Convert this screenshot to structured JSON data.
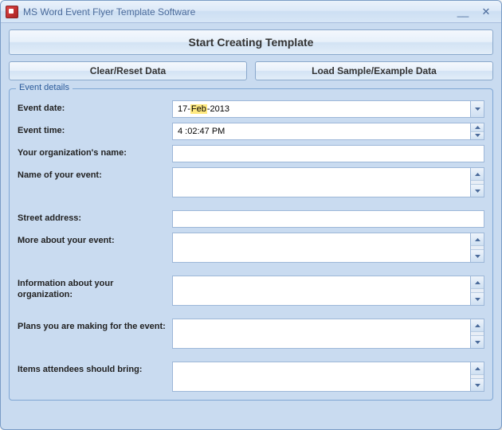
{
  "window": {
    "title": "MS Word Event Flyer Template Software"
  },
  "buttons": {
    "start": "Start Creating Template",
    "clear": "Clear/Reset Data",
    "load": "Load Sample/Example Data"
  },
  "group": {
    "legend": "Event details"
  },
  "form": {
    "event_date": {
      "label": "Event date:",
      "day": "17-",
      "month": "Feb",
      "year": "-2013"
    },
    "event_time": {
      "label": "Event time:",
      "value": " 4 :02:47 PM"
    },
    "org_name": {
      "label": "Your organization's name:",
      "value": ""
    },
    "event_name": {
      "label": "Name of your event:",
      "value": ""
    },
    "street": {
      "label": "Street address:",
      "value": ""
    },
    "more": {
      "label": "More about your event:",
      "value": ""
    },
    "info_org": {
      "label": "Information about your organization:",
      "value": ""
    },
    "plans": {
      "label": "Plans you are making for the event:",
      "value": ""
    },
    "items": {
      "label": "Items attendees should bring:",
      "value": ""
    }
  }
}
